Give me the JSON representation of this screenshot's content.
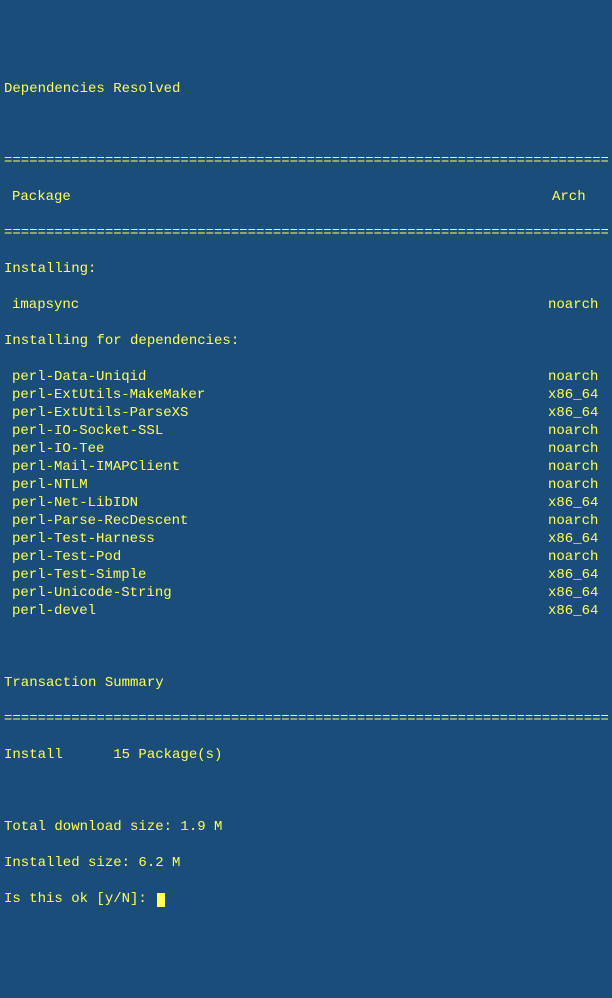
{
  "title": "Dependencies Resolved",
  "rule": "==============================================================================",
  "headers": {
    "package": "Package",
    "arch": "Arch"
  },
  "sections": {
    "installing": "Installing:",
    "installing_deps": "Installing for dependencies:"
  },
  "main_package": {
    "name": "imapsync",
    "arch": "noarch"
  },
  "deps": [
    {
      "name": "perl-Data-Uniqid",
      "arch": "noarch"
    },
    {
      "name": "perl-ExtUtils-MakeMaker",
      "arch": "x86_64"
    },
    {
      "name": "perl-ExtUtils-ParseXS",
      "arch": "x86_64"
    },
    {
      "name": "perl-IO-Socket-SSL",
      "arch": "noarch"
    },
    {
      "name": "perl-IO-Tee",
      "arch": "noarch"
    },
    {
      "name": "perl-Mail-IMAPClient",
      "arch": "noarch"
    },
    {
      "name": "perl-NTLM",
      "arch": "noarch"
    },
    {
      "name": "perl-Net-LibIDN",
      "arch": "x86_64"
    },
    {
      "name": "perl-Parse-RecDescent",
      "arch": "noarch"
    },
    {
      "name": "perl-Test-Harness",
      "arch": "x86_64"
    },
    {
      "name": "perl-Test-Pod",
      "arch": "noarch"
    },
    {
      "name": "perl-Test-Simple",
      "arch": "x86_64"
    },
    {
      "name": "perl-Unicode-String",
      "arch": "x86_64"
    },
    {
      "name": "perl-devel",
      "arch": "x86_64"
    }
  ],
  "summary": {
    "title": "Transaction Summary",
    "install": "Install      15 Package(s)",
    "download_size": "Total download size: 1.9 M",
    "installed_size": "Installed size: 6.2 M",
    "prompt": "Is this ok [y/N]: "
  }
}
